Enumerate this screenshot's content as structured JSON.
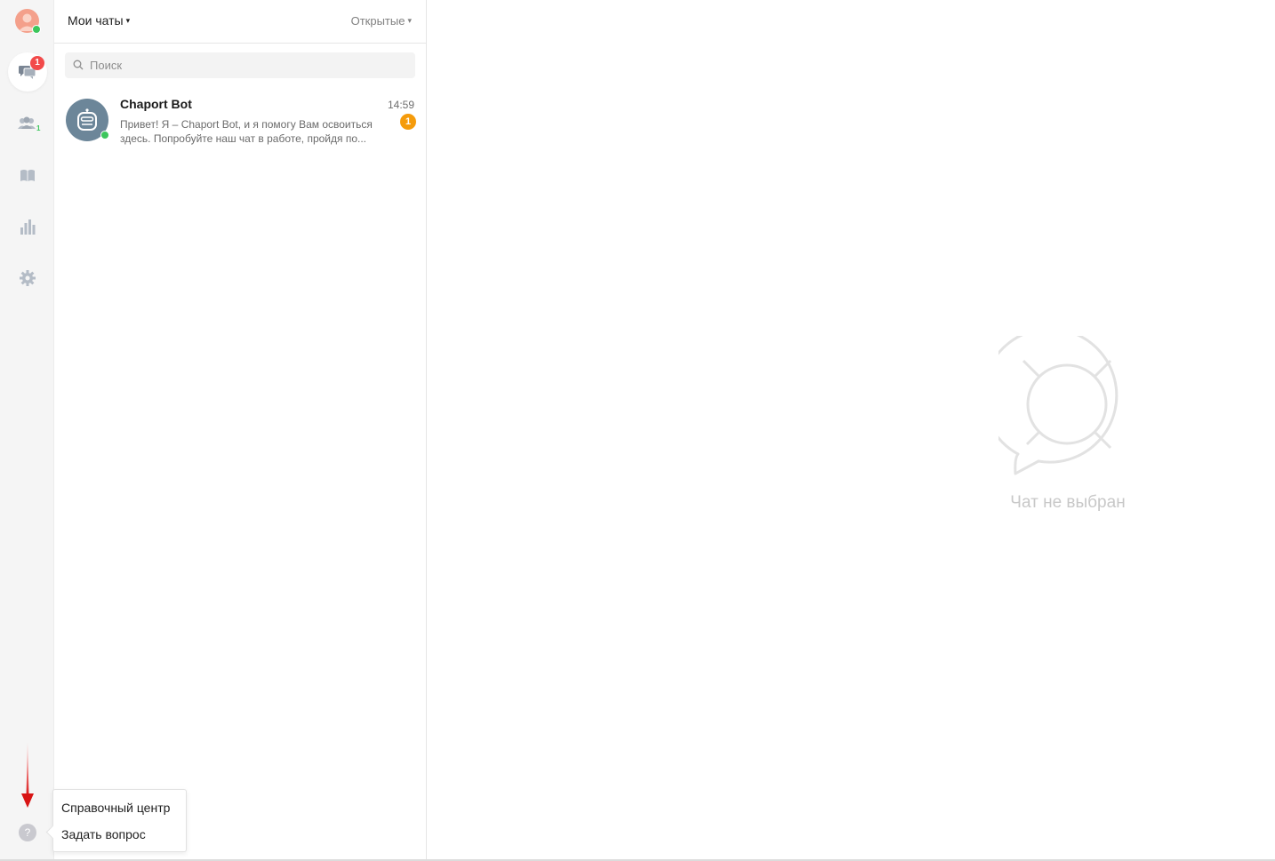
{
  "header": {
    "title": "Мои чаты",
    "filter": "Открытые"
  },
  "rail": {
    "chats_badge": "1",
    "visitors_sub": "1",
    "help_glyph": "?"
  },
  "search": {
    "placeholder": "Поиск"
  },
  "chats": [
    {
      "name": "Chaport Bot",
      "time": "14:59",
      "preview": "Привет! Я – Chaport Bot, и я помогу Вам освоиться здесь. Попробуйте наш чат в работе, пройдя по...",
      "unread": "1"
    }
  ],
  "empty_state": {
    "label": "Чат не выбран"
  },
  "help_menu": {
    "items": [
      "Справочный центр",
      "Задать вопрос"
    ]
  },
  "colors": {
    "online": "#3cc65c",
    "badge_red": "#f24a4a",
    "badge_orange": "#f59b0b",
    "annotation_arrow": "#e02020"
  },
  "icons": {
    "rail": [
      "operator-avatar-icon",
      "chats-icon",
      "visitors-icon",
      "knowledge-base-icon",
      "reports-icon",
      "settings-icon",
      "help-icon"
    ],
    "annotation": "red-arrow-down-icon"
  }
}
